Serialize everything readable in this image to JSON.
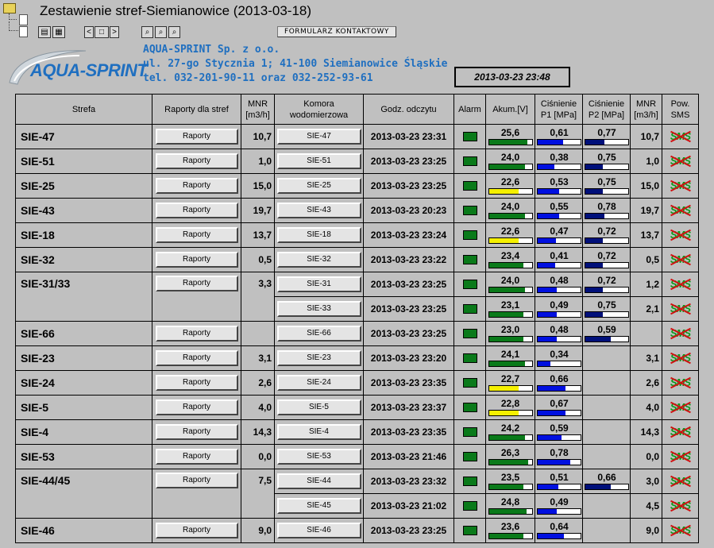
{
  "header": {
    "title": "Zestawienie stref-Siemianowice (2013-03-18)",
    "form_button": "FORMULARZ KONTAKTOWY",
    "nav_prev": "<",
    "nav_mid": "□",
    "nav_next": ">"
  },
  "logo": {
    "text": "AQUA-SPRINT"
  },
  "company": {
    "name": "AQUA-SPRINT Sp. z o.o.",
    "address": "ul. 27-go Stycznia 1; 41-100 Siemianowice Śląskie",
    "phone": "tel. 032-201-90-11 oraz 032-252-93-61"
  },
  "datetime": "2013-03-23 23:48",
  "columns": [
    "Strefa",
    "Raporty dla stref",
    "MNR [m3/h]",
    "Komora wodomierzowa",
    "Godz. odczytu",
    "Alarm",
    "Akum.[V]",
    "Ciśnienie P1 [MPa]",
    "Ciśnienie P2 [MPa]",
    "MNR [m3/h]",
    "Pow. SMS"
  ],
  "report_label": "Raporty",
  "sms_label": "SMS",
  "colors": {
    "green": "#0a7a1a",
    "yellow": "#f5f000",
    "blue": "#0010e0",
    "navy": "#00107a"
  },
  "rows": [
    {
      "strefa": "SIE-47",
      "mnr": "10,7",
      "komora": "SIE-47",
      "godz": "2013-03-23 23:31",
      "akum": "25,6",
      "akum_lvl": 0.9,
      "akum_col": "green",
      "p1": "0,61",
      "p1_lvl": 0.6,
      "p2": "0,77",
      "p2_lvl": 0.45,
      "mnr2": "10,7"
    },
    {
      "strefa": "SIE-51",
      "mnr": "1,0",
      "komora": "SIE-51",
      "godz": "2013-03-23 23:25",
      "akum": "24,0",
      "akum_lvl": 0.85,
      "akum_col": "green",
      "p1": "0,38",
      "p1_lvl": 0.38,
      "p2": "0,75",
      "p2_lvl": 0.4,
      "mnr2": "1,0"
    },
    {
      "strefa": "SIE-25",
      "mnr": "15,0",
      "komora": "SIE-25",
      "godz": "2013-03-23 23:25",
      "akum": "22,6",
      "akum_lvl": 0.7,
      "akum_col": "yellow",
      "p1": "0,53",
      "p1_lvl": 0.5,
      "p2": "0,75",
      "p2_lvl": 0.4,
      "mnr2": "15,0"
    },
    {
      "strefa": "SIE-43",
      "mnr": "19,7",
      "komora": "SIE-43",
      "godz": "2013-03-23 20:23",
      "akum": "24,0",
      "akum_lvl": 0.85,
      "akum_col": "green",
      "p1": "0,55",
      "p1_lvl": 0.5,
      "p2": "0,78",
      "p2_lvl": 0.45,
      "mnr2": "19,7"
    },
    {
      "strefa": "SIE-18",
      "mnr": "13,7",
      "komora": "SIE-18",
      "godz": "2013-03-23 23:24",
      "akum": "22,6",
      "akum_lvl": 0.7,
      "akum_col": "yellow",
      "p1": "0,47",
      "p1_lvl": 0.42,
      "p2": "0,72",
      "p2_lvl": 0.4,
      "mnr2": "13,7"
    },
    {
      "strefa": "SIE-32",
      "mnr": "0,5",
      "komora": "SIE-32",
      "godz": "2013-03-23 23:22",
      "akum": "23,4",
      "akum_lvl": 0.8,
      "akum_col": "green",
      "p1": "0,41",
      "p1_lvl": 0.4,
      "p2": "0,72",
      "p2_lvl": 0.4,
      "mnr2": "0,5"
    },
    {
      "strefa": "SIE-31/33",
      "mnr": "3,3",
      "komora": "SIE-31",
      "godz": "2013-03-23 23:25",
      "akum": "24,0",
      "akum_lvl": 0.85,
      "akum_col": "green",
      "p1": "0,48",
      "p1_lvl": 0.45,
      "p2": "0,72",
      "p2_lvl": 0.4,
      "mnr2": "1,2"
    },
    {
      "strefa": "",
      "mnr": "",
      "komora": "SIE-33",
      "godz": "2013-03-23 23:25",
      "akum": "23,1",
      "akum_lvl": 0.8,
      "akum_col": "green",
      "p1": "0,49",
      "p1_lvl": 0.45,
      "p2": "0,75",
      "p2_lvl": 0.4,
      "mnr2": "2,1"
    },
    {
      "strefa": "SIE-66",
      "mnr": "",
      "komora": "SIE-66",
      "godz": "2013-03-23 23:25",
      "akum": "23,0",
      "akum_lvl": 0.8,
      "akum_col": "green",
      "p1": "0,48",
      "p1_lvl": 0.45,
      "p2": "0,59",
      "p2_lvl": 0.6,
      "mnr2": ""
    },
    {
      "strefa": "SIE-23",
      "mnr": "3,1",
      "komora": "SIE-23",
      "godz": "2013-03-23 23:20",
      "akum": "24,1",
      "akum_lvl": 0.85,
      "akum_col": "green",
      "p1": "0,34",
      "p1_lvl": 0.3,
      "p2": "",
      "p2_lvl": 0,
      "mnr2": "3,1"
    },
    {
      "strefa": "SIE-24",
      "mnr": "2,6",
      "komora": "SIE-24",
      "godz": "2013-03-23 23:35",
      "akum": "22,7",
      "akum_lvl": 0.7,
      "akum_col": "yellow",
      "p1": "0,66",
      "p1_lvl": 0.65,
      "p2": "",
      "p2_lvl": 0,
      "mnr2": "2,6"
    },
    {
      "strefa": "SIE-5",
      "mnr": "4,0",
      "komora": "SIE-5",
      "godz": "2013-03-23 23:37",
      "akum": "22,8",
      "akum_lvl": 0.7,
      "akum_col": "yellow",
      "p1": "0,67",
      "p1_lvl": 0.65,
      "p2": "",
      "p2_lvl": 0,
      "mnr2": "4,0"
    },
    {
      "strefa": "SIE-4",
      "mnr": "14,3",
      "komora": "SIE-4",
      "godz": "2013-03-23 23:35",
      "akum": "24,2",
      "akum_lvl": 0.85,
      "akum_col": "green",
      "p1": "0,59",
      "p1_lvl": 0.55,
      "p2": "",
      "p2_lvl": 0,
      "mnr2": "14,3"
    },
    {
      "strefa": "SIE-53",
      "mnr": "0,0",
      "komora": "SIE-53",
      "godz": "2013-03-23 21:46",
      "akum": "26,3",
      "akum_lvl": 0.92,
      "akum_col": "green",
      "p1": "0,78",
      "p1_lvl": 0.75,
      "p2": "",
      "p2_lvl": 0,
      "mnr2": "0,0"
    },
    {
      "strefa": "SIE-44/45",
      "mnr": "7,5",
      "komora": "SIE-44",
      "godz": "2013-03-23 23:32",
      "akum": "23,5",
      "akum_lvl": 0.8,
      "akum_col": "green",
      "p1": "0,51",
      "p1_lvl": 0.48,
      "p2": "0,66",
      "p2_lvl": 0.6,
      "mnr2": "3,0"
    },
    {
      "strefa": "",
      "mnr": "",
      "komora": "SIE-45",
      "godz": "2013-03-23 21:02",
      "akum": "24,8",
      "akum_lvl": 0.88,
      "akum_col": "green",
      "p1": "0,49",
      "p1_lvl": 0.45,
      "p2": "",
      "p2_lvl": 0,
      "mnr2": "4,5"
    },
    {
      "strefa": "SIE-46",
      "mnr": "9,0",
      "komora": "SIE-46",
      "godz": "2013-03-23 23:25",
      "akum": "23,6",
      "akum_lvl": 0.8,
      "akum_col": "green",
      "p1": "0,64",
      "p1_lvl": 0.62,
      "p2": "",
      "p2_lvl": 0,
      "mnr2": "9,0"
    }
  ]
}
